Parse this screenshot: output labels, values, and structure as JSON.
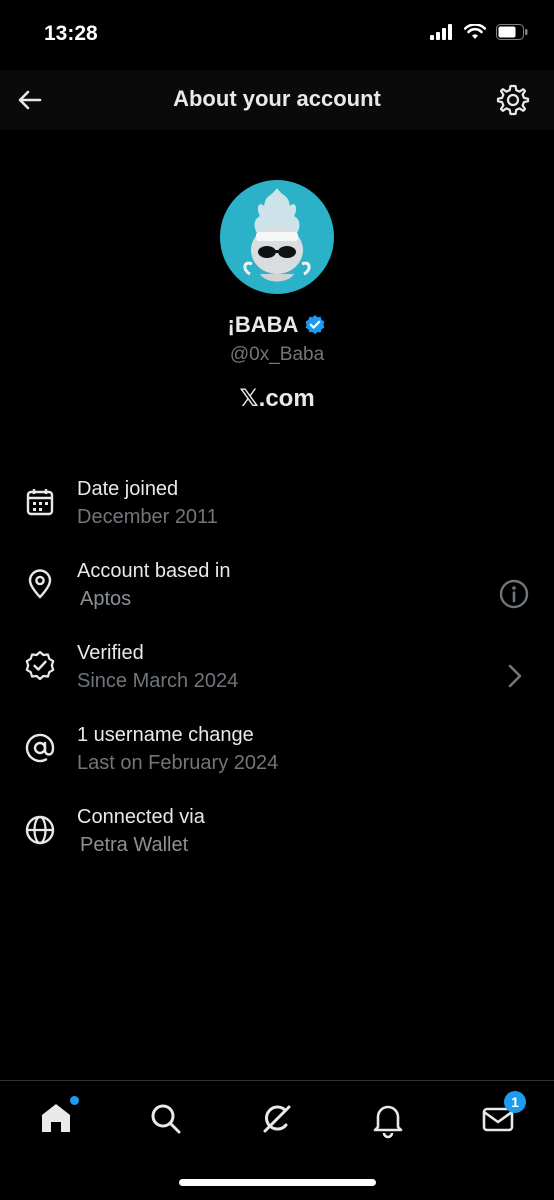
{
  "status_bar": {
    "time": "13:28"
  },
  "header": {
    "title": "About your account"
  },
  "profile": {
    "display_name": "¡BABA",
    "handle": "@0x_Baba",
    "site": "𝕏.com"
  },
  "info": [
    {
      "label": "Date joined",
      "value": "December 2011",
      "icon": "calendar-icon"
    },
    {
      "label": "Account based in",
      "value": "Aptos",
      "icon": "location-pin-icon"
    },
    {
      "label": "Verified",
      "value": "Since March 2024",
      "icon": "verified-badge-icon"
    },
    {
      "label": "1 username change",
      "value": "Last on February 2024",
      "icon": "at-sign-icon"
    },
    {
      "label": "Connected via",
      "value": "Petra Wallet",
      "icon": "globe-icon"
    }
  ],
  "tab_bar": {
    "messages_badge": "1"
  },
  "colors": {
    "accent": "#1d9bf0",
    "secondary_text": "#71767b",
    "avatar_bg": "#2bb1c8"
  }
}
